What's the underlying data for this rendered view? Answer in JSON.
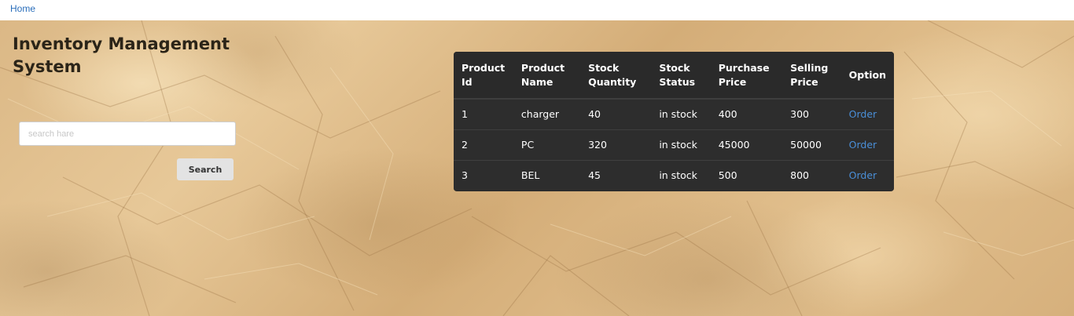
{
  "nav": {
    "home_label": "Home"
  },
  "page": {
    "title": "Inventory Management System"
  },
  "search": {
    "placeholder": "search hare",
    "value": "",
    "button_label": "Search"
  },
  "table": {
    "headers": {
      "id": "Product Id",
      "name": "Product Name",
      "qty": "Stock Quantity",
      "status": "Stock Status",
      "purchase": "Purchase Price",
      "selling": "Selling Price",
      "option": "Option"
    },
    "rows": [
      {
        "id": "1",
        "name": "charger",
        "qty": "40",
        "status": "in stock",
        "purchase": "400",
        "selling": "300",
        "option": "Order"
      },
      {
        "id": "2",
        "name": "PC",
        "qty": "320",
        "status": "in stock",
        "purchase": "45000",
        "selling": "50000",
        "option": "Order"
      },
      {
        "id": "3",
        "name": "BEL",
        "qty": "45",
        "status": "in stock",
        "purchase": "500",
        "selling": "800",
        "option": "Order"
      }
    ]
  },
  "colors": {
    "link": "#2a6ebb",
    "table_bg": "#2b2b2b",
    "order_link": "#4a8fd8",
    "paper": "#dbb886"
  }
}
